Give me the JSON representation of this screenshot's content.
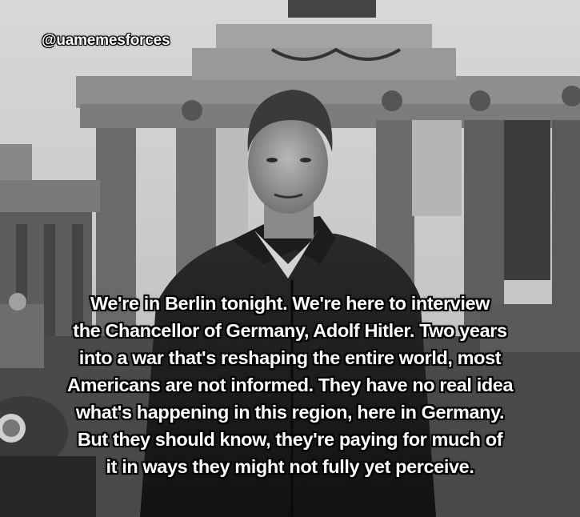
{
  "watermark": "@uamemesforces",
  "caption": {
    "lines": [
      "We're in Berlin tonight. We're here to interview",
      "the Chancellor of Germany, Adolf Hitler. Two years",
      "into a war that's reshaping the entire world, most",
      "Americans are not informed. They have no real idea",
      "what's happening in this region, here in Germany.",
      "But they should know, they're paying for much of",
      "it in ways they might not fully yet perceive."
    ]
  }
}
